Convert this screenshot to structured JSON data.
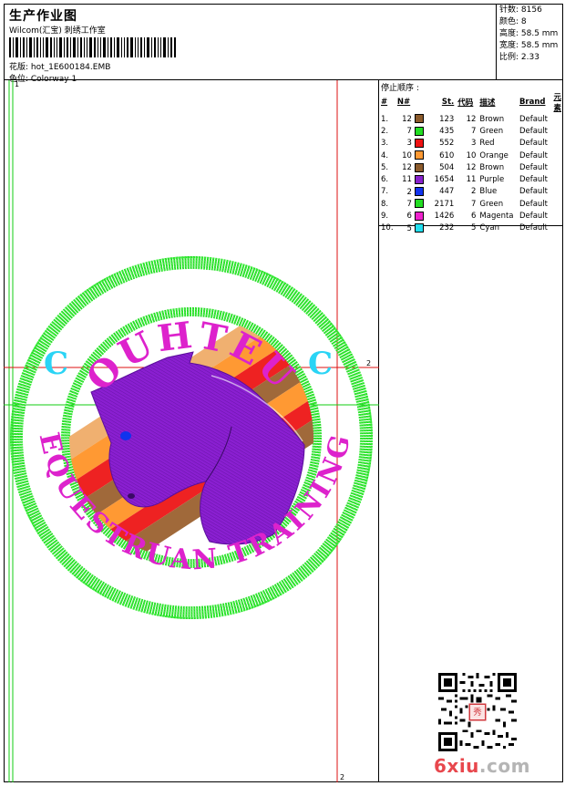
{
  "header": {
    "title": "生产作业图",
    "subtitle": "Wilcom(汇宝) 刺绣工作室",
    "design_label": "花版: hot_1E600184.EMB",
    "color_label": "色位: Colorway 1"
  },
  "stats": {
    "stitches": "针数: 8156",
    "colors": "颜色: 8",
    "height": "高度: 58.5 mm",
    "width": "宽度: 58.5 mm",
    "ratio": "比例: 2.33"
  },
  "stop_sequence": {
    "title": "停止顺序 :",
    "headers": [
      "#",
      "N#",
      "St.",
      "代码",
      "描述",
      "Brand",
      "元素"
    ],
    "rows": [
      {
        "idx": "1.",
        "needle": "12",
        "color": "#8b5a2b",
        "st": "123",
        "code": "12",
        "desc": "Brown",
        "brand": "Default"
      },
      {
        "idx": "2.",
        "needle": "7",
        "color": "#22dd22",
        "st": "435",
        "code": "7",
        "desc": "Green",
        "brand": "Default"
      },
      {
        "idx": "3.",
        "needle": "3",
        "color": "#ee1111",
        "st": "552",
        "code": "3",
        "desc": "Red",
        "brand": "Default"
      },
      {
        "idx": "4.",
        "needle": "10",
        "color": "#ff9933",
        "st": "610",
        "code": "10",
        "desc": "Orange",
        "brand": "Default"
      },
      {
        "idx": "5.",
        "needle": "12",
        "color": "#8b5a2b",
        "st": "504",
        "code": "12",
        "desc": "Brown",
        "brand": "Default"
      },
      {
        "idx": "6.",
        "needle": "11",
        "color": "#8822cc",
        "st": "1654",
        "code": "11",
        "desc": "Purple",
        "brand": "Default"
      },
      {
        "idx": "7.",
        "needle": "2",
        "color": "#1133ee",
        "st": "447",
        "code": "2",
        "desc": "Blue",
        "brand": "Default"
      },
      {
        "idx": "8.",
        "needle": "7",
        "color": "#22dd22",
        "st": "2171",
        "code": "7",
        "desc": "Green",
        "brand": "Default"
      },
      {
        "idx": "9.",
        "needle": "6",
        "color": "#ee22cc",
        "st": "1426",
        "code": "6",
        "desc": "Magenta",
        "brand": "Default"
      },
      {
        "idx": "10.",
        "needle": "5",
        "color": "#22e0f0",
        "st": "232",
        "code": "5",
        "desc": "Cyan",
        "brand": "Default"
      }
    ]
  },
  "design": {
    "top_text": "OUHTEU",
    "arc_text": "EQUESTRUAN TRAINING",
    "marker_top": "1",
    "marker_right": "2",
    "marker_bottom": "2"
  },
  "watermark": {
    "text_a": "6xiu",
    "text_b": ".com"
  },
  "colors": {
    "green": "#33ee33",
    "magenta": "#dd22cc",
    "purple": "#8a1fd1",
    "cyan": "#2ad4f5"
  }
}
